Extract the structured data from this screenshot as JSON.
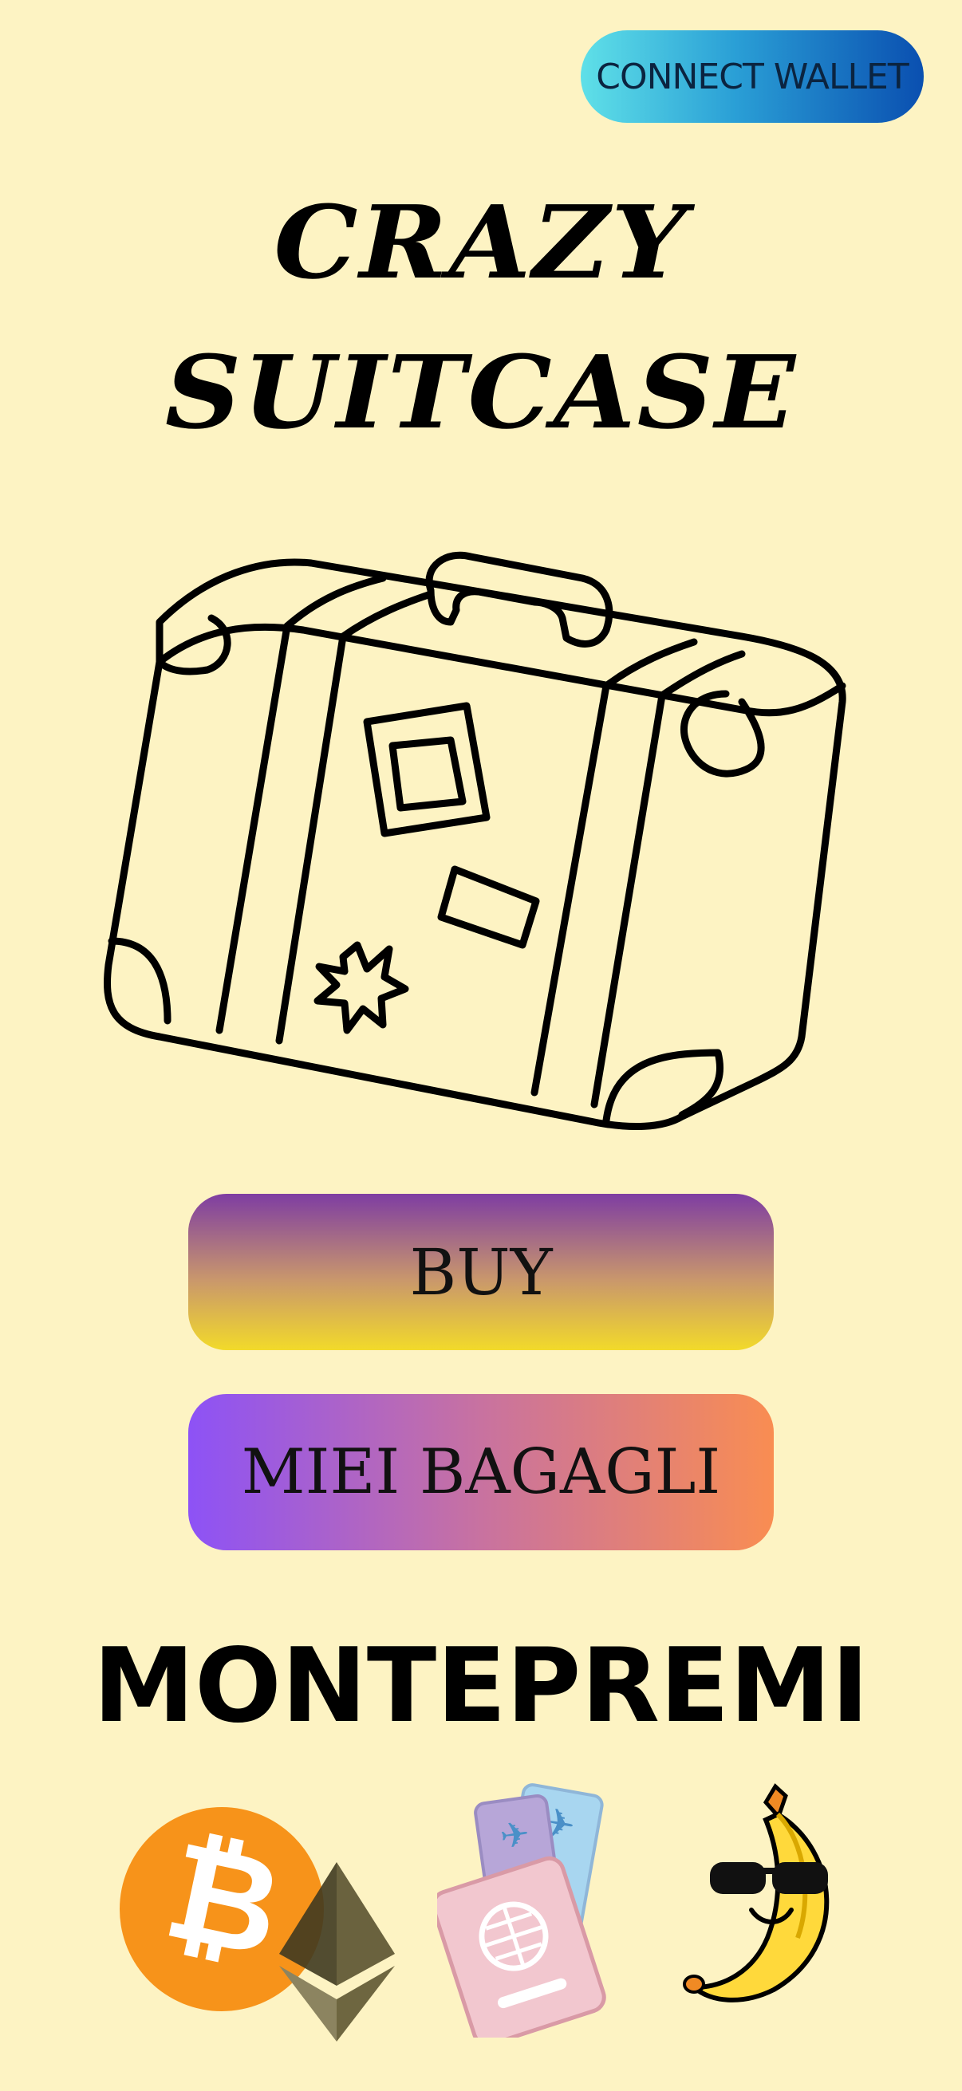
{
  "header": {
    "connect_wallet_label": "CONNECT WALLET"
  },
  "title": {
    "line1": "CRAZY",
    "line2": "SUITCASE"
  },
  "actions": {
    "buy_label": "BUY",
    "bagagli_label": "MIEI BAGAGLI"
  },
  "prizes": {
    "title": "MONTEPREMI",
    "items": [
      "bitcoin-icon",
      "ethereum-icon",
      "passport-tickets-icon",
      "cool-banana-icon"
    ]
  },
  "colors": {
    "background": "#fdf3c3",
    "connect_gradient": [
      "#5fe0e8",
      "#0a4fb0"
    ],
    "buy_gradient": [
      "#7e3da2",
      "#f2da2a"
    ],
    "bagagli_gradient": [
      "#8d52f6",
      "#f98d52"
    ]
  }
}
